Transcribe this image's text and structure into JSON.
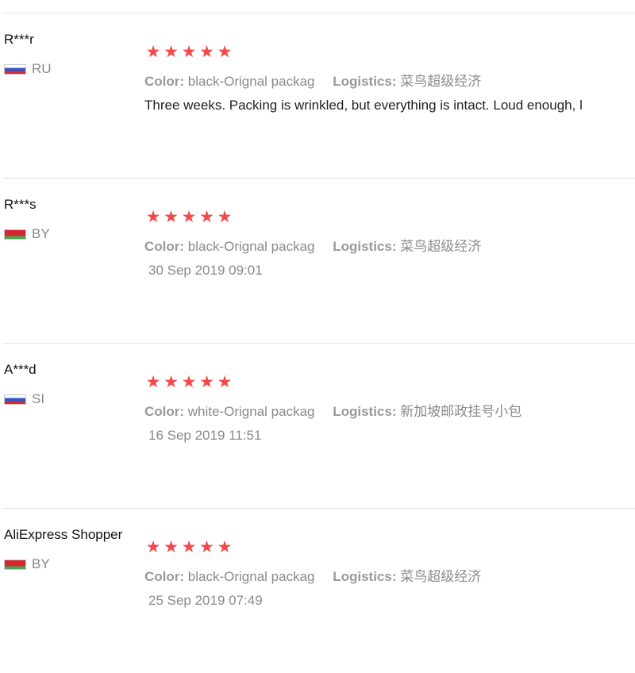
{
  "reviews": [
    {
      "user": "R***r",
      "country": "RU",
      "flag": "russia-flag",
      "stars": "★★★★★",
      "color_label": "Color:",
      "color_value": "black-Orignal packag",
      "logistics_label": "Logistics:",
      "logistics_value": "菜鸟超级经济",
      "feedback": "Three weeks. Packing is wrinkled, but everything is intact. Loud enough, l",
      "date": ""
    },
    {
      "user": "R***s",
      "country": "BY",
      "flag": "belarus-flag",
      "stars": "★★★★★",
      "color_label": "Color:",
      "color_value": "black-Orignal packag",
      "logistics_label": "Logistics:",
      "logistics_value": "菜鸟超级经济",
      "feedback": "",
      "date": "30 Sep 2019 09:01"
    },
    {
      "user": "A***d",
      "country": "SI",
      "flag": "slovenia-flag",
      "stars": "★★★★★",
      "color_label": "Color:",
      "color_value": "white-Orignal packag",
      "logistics_label": "Logistics:",
      "logistics_value": "新加坡邮政挂号小包",
      "feedback": "",
      "date": "16 Sep 2019 11:51"
    },
    {
      "user": "AliExpress Shopper",
      "country": "BY",
      "flag": "belarus-flag",
      "stars": "★★★★★",
      "color_label": "Color:",
      "color_value": "black-Orignal packag",
      "logistics_label": "Logistics:",
      "logistics_value": "菜鸟超级经济",
      "feedback": "",
      "date": "25 Sep 2019 07:49"
    }
  ],
  "colors": {
    "star": "#f24a4a",
    "divider": "#e4e4e4",
    "muted_text": "#8a8a8a"
  }
}
